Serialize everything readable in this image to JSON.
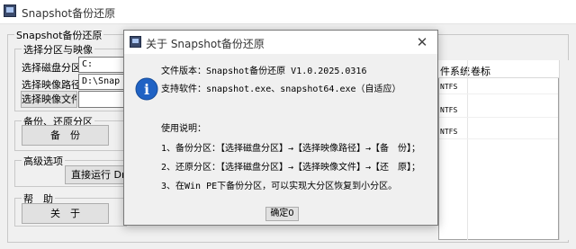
{
  "main": {
    "title": "Snapshot备份还原",
    "group_title": "Snapshot备份还原",
    "partition_group": "选择分区与映像",
    "disk_label": "选择磁盘分区：",
    "disk_value": "C:",
    "image_path_label": "选择映像路径：",
    "image_path_value": "D:\\Snap",
    "select_image_button": "选择映像文件",
    "backup_restore_group": "备份、还原分区",
    "backup_button": "备　份",
    "advanced_group": "高级选项",
    "run_drive_button": "直接运行 Drive",
    "help_group": "帮　助",
    "about_button": "关　于",
    "table": {
      "headers": [
        "件系统",
        "卷标"
      ],
      "rows": [
        [
          "NTFS",
          ""
        ],
        [
          "NTFS",
          ""
        ],
        [
          "NTFS",
          ""
        ]
      ]
    }
  },
  "dialog": {
    "title": "关于 Snapshot备份还原",
    "close_glyph": "✕",
    "icon_glyph": "i",
    "version_line": "文件版本：Snapshot备份还原 V1.0.2025.0316",
    "support_line": "支持软件：snapshot.exe、snapshot64.exe（自适应）",
    "usage_title": "使用说明：",
    "step1": "1、备份分区：【选择磁盘分区】→【选择映像路径】→【备　份】；",
    "step2": "2、还原分区：【选择磁盘分区】→【选择映像文件】→【还　原】；",
    "step3": "3、在Win PE下备份分区，可以实现大分区恢复到小分区。",
    "ok_button": "确定0"
  },
  "colors": {
    "info_icon": "#1f62c4",
    "window_bg": "#f0f0f0",
    "title_bg": "#ffffff"
  }
}
